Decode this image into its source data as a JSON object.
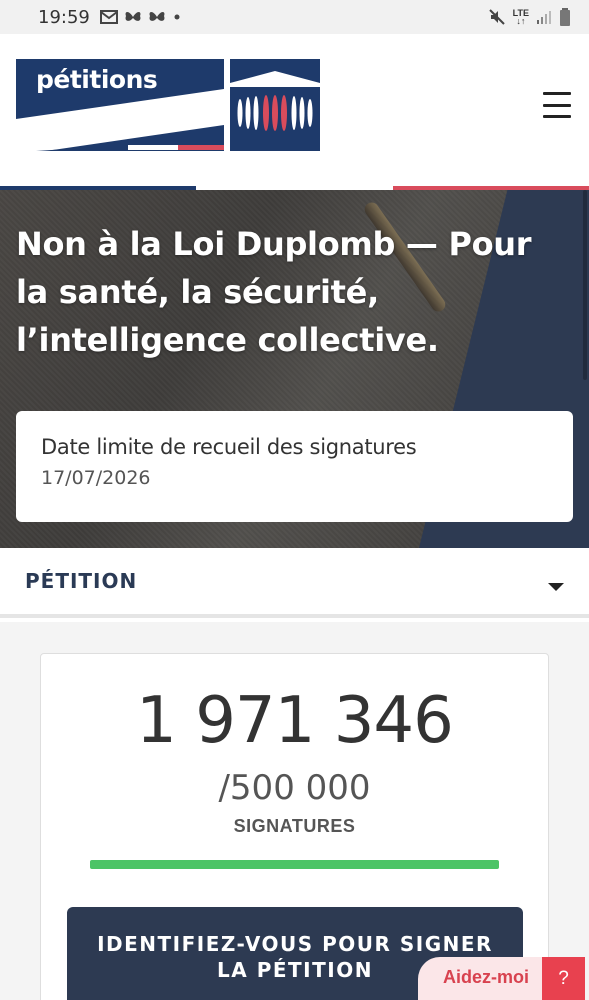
{
  "status_bar": {
    "time": "19:59",
    "network": "LTE"
  },
  "header": {
    "logo_text": "pétitions"
  },
  "hero": {
    "title": "Non à la Loi Duplomb — Pour la santé, la sécurité, l’intelligence collective.",
    "deadline_label": "Date limite de recueil des signatures",
    "deadline_date": "17/07/2026"
  },
  "section": {
    "title": "PÉTITION"
  },
  "signatures": {
    "count": "1 971 346",
    "goal": "/500 000",
    "label": "SIGNATURES",
    "progress_percent": 100
  },
  "sign_button": {
    "line1": "IDENTIFIEZ-VOUS POUR SIGNER",
    "line2": "LA PÉTITION"
  },
  "help": {
    "label": "Aidez-moi",
    "icon": "?"
  },
  "colors": {
    "navy": "#1e3a6b",
    "red": "#d94c5c",
    "green": "#4cc466",
    "button": "#2d3a52"
  }
}
